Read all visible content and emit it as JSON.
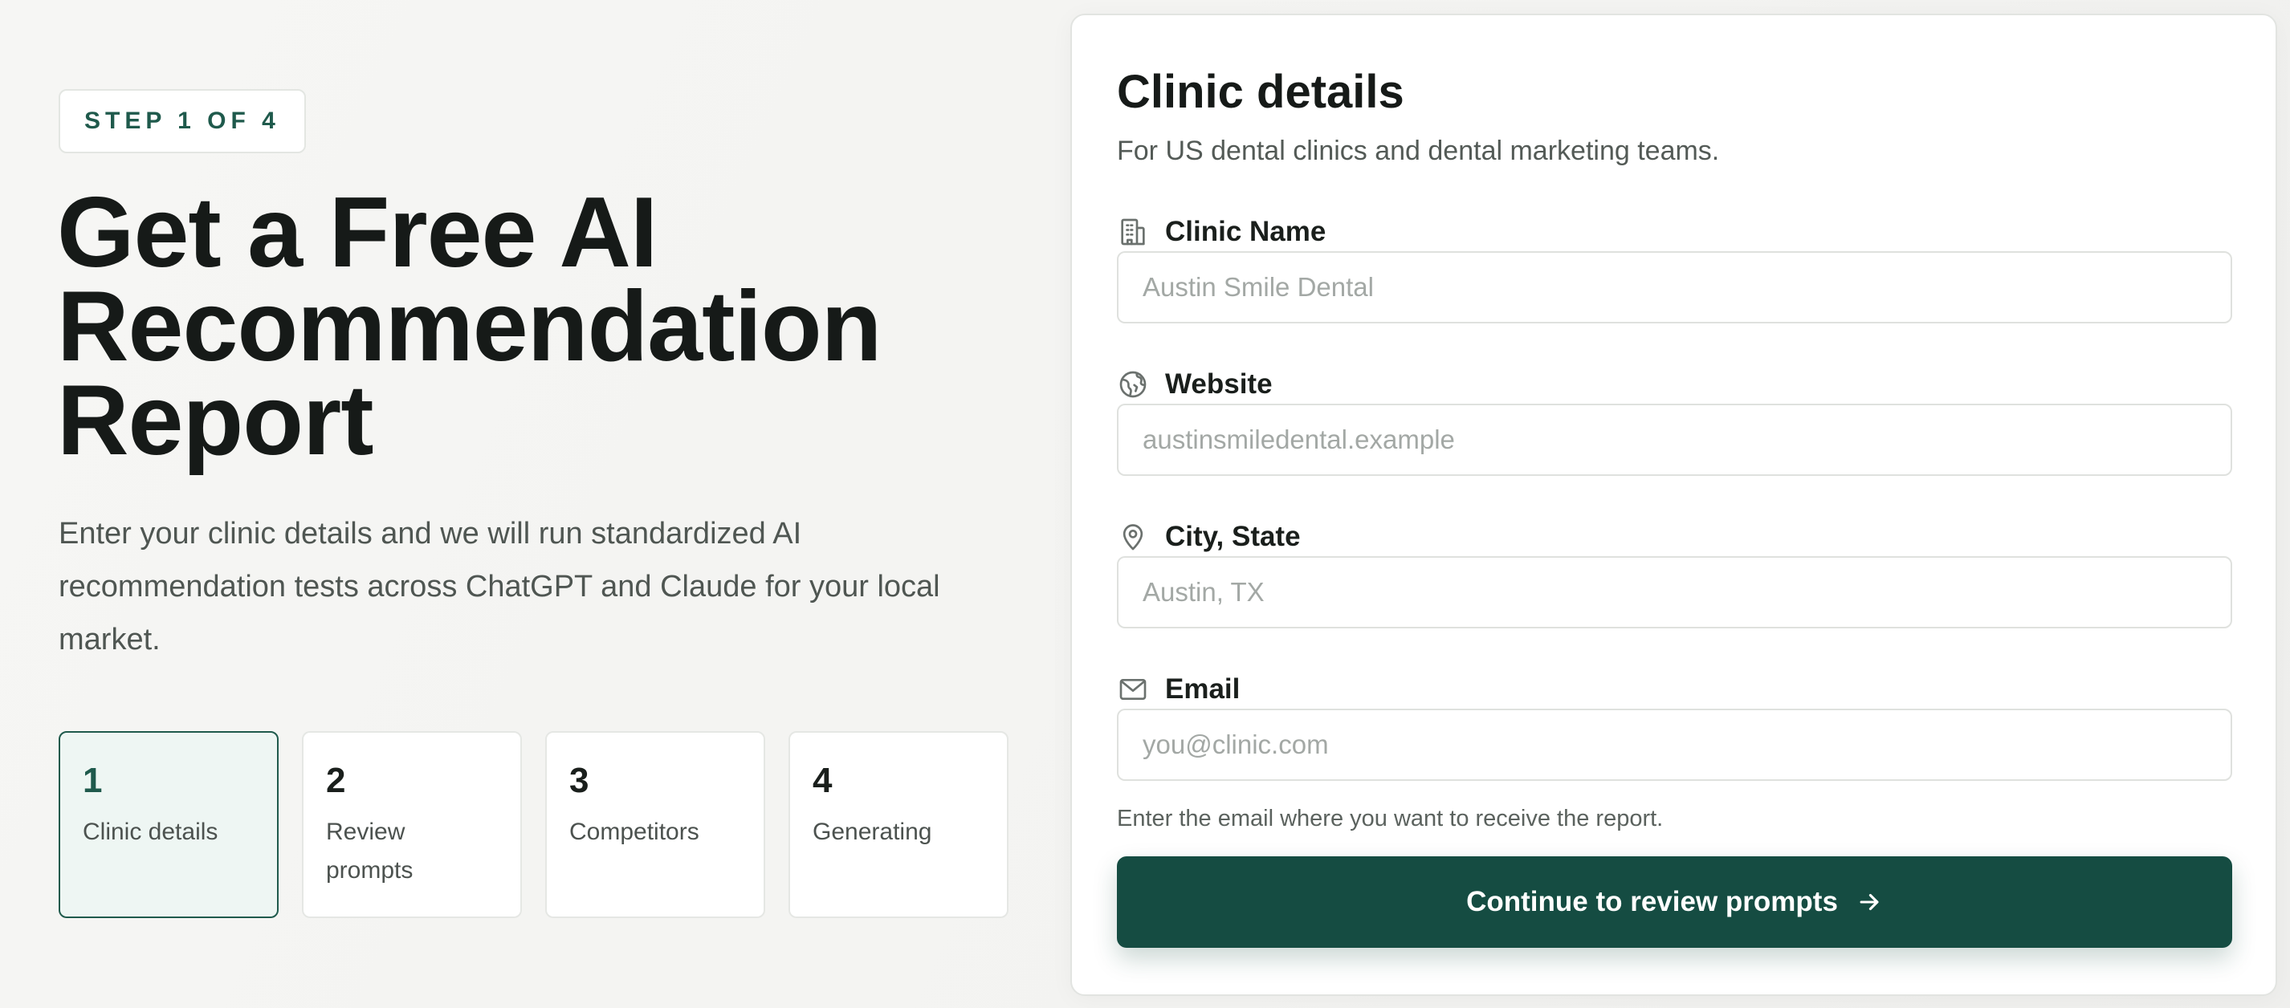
{
  "hero": {
    "step_badge": "STEP 1 OF 4",
    "title_line1": "Get a Free AI",
    "title_line2": "Recommendation",
    "title_line3": "Report",
    "description": "Enter your clinic details and we will run standardized AI recommendation tests across ChatGPT and Claude for your local market."
  },
  "steps": [
    {
      "number": "1",
      "label": "Clinic details",
      "active": true
    },
    {
      "number": "2",
      "label": "Review prompts",
      "active": false
    },
    {
      "number": "3",
      "label": "Competitors",
      "active": false
    },
    {
      "number": "4",
      "label": "Generating",
      "active": false
    }
  ],
  "form": {
    "title": "Clinic details",
    "subtitle": "For US dental clinics and dental marketing teams.",
    "fields": [
      {
        "label": "Clinic Name",
        "icon": "building-icon",
        "placeholder": "Austin Smile Dental",
        "value": ""
      },
      {
        "label": "Website",
        "icon": "globe-icon",
        "placeholder": "austinsmiledental.example",
        "value": ""
      },
      {
        "label": "City, State",
        "icon": "map-pin-icon",
        "placeholder": "Austin, TX",
        "value": ""
      },
      {
        "label": "Email",
        "icon": "mail-icon",
        "placeholder": "you@clinic.com",
        "value": ""
      }
    ],
    "email_helper": "Enter the email where you want to receive the report.",
    "submit_label": "Continue to review prompts",
    "submit_icon": "arrow-right-icon"
  },
  "colors": {
    "accent": "#154c42",
    "accent_text": "#1f5a4c",
    "active_step_bg": "#eef6f3",
    "page_bg": "#f5f5f3"
  }
}
